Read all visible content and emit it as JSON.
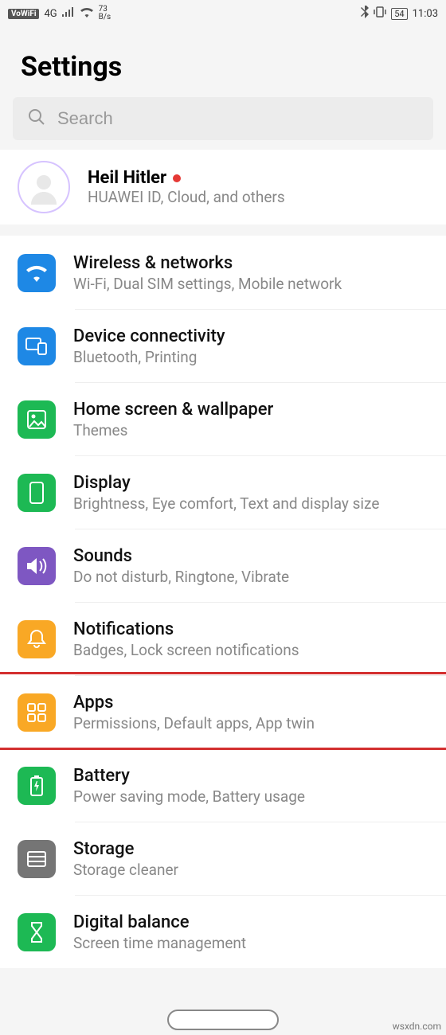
{
  "status": {
    "vowifi": "VoWiFi",
    "net": "4G",
    "speed_top": "73",
    "speed_unit": "B/s",
    "battery": "54",
    "time": "11:03"
  },
  "header": {
    "title": "Settings"
  },
  "search": {
    "placeholder": "Search"
  },
  "account": {
    "name": "Heil Hitler",
    "sub": "HUAWEI ID, Cloud, and others"
  },
  "rows": [
    {
      "id": "wireless",
      "title": "Wireless & networks",
      "sub": "Wi-Fi, Dual SIM settings, Mobile network",
      "color": "#1e88e5"
    },
    {
      "id": "device",
      "title": "Device connectivity",
      "sub": "Bluetooth, Printing",
      "color": "#1e88e5"
    },
    {
      "id": "home",
      "title": "Home screen & wallpaper",
      "sub": "Themes",
      "color": "#1db954"
    },
    {
      "id": "display",
      "title": "Display",
      "sub": "Brightness, Eye comfort, Text and display size",
      "color": "#1db954"
    },
    {
      "id": "sounds",
      "title": "Sounds",
      "sub": "Do not disturb, Ringtone, Vibrate",
      "color": "#7e57c2"
    },
    {
      "id": "notif",
      "title": "Notifications",
      "sub": "Badges, Lock screen notifications",
      "color": "#f9a825"
    },
    {
      "id": "apps",
      "title": "Apps",
      "sub": "Permissions, Default apps, App twin",
      "color": "#f9a825"
    },
    {
      "id": "battery",
      "title": "Battery",
      "sub": "Power saving mode, Battery usage",
      "color": "#1db954"
    },
    {
      "id": "storage",
      "title": "Storage",
      "sub": "Storage cleaner",
      "color": "#757575"
    },
    {
      "id": "digital",
      "title": "Digital balance",
      "sub": "Screen time management",
      "color": "#1db954"
    }
  ],
  "highlight_row": "apps",
  "watermark": "wsxdn.com"
}
